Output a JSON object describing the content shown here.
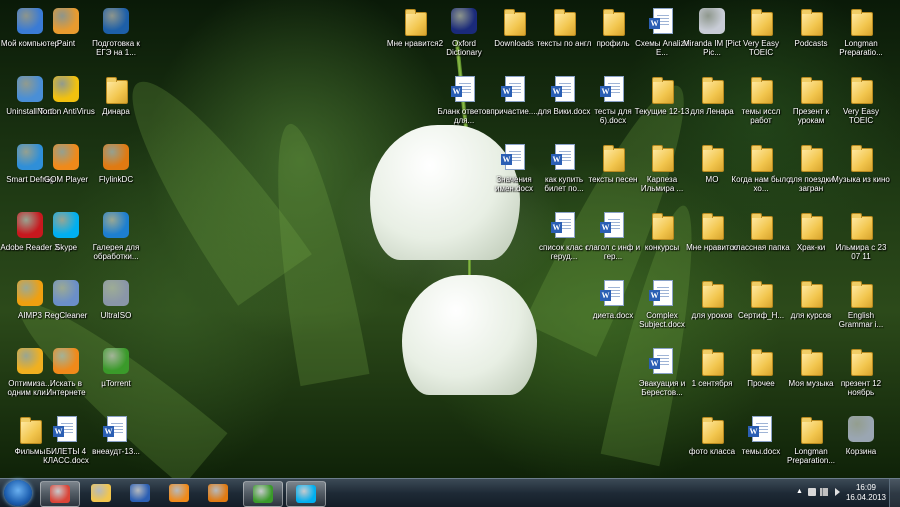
{
  "desktop": {
    "icons": [
      {
        "label": "Мой компьютер",
        "icon": "computer-icon",
        "kind": "app",
        "color": "#3a7bd5"
      },
      {
        "label": "Paint",
        "icon": "paint-icon",
        "kind": "app",
        "color": "#e89b2f"
      },
      {
        "label": "Подготовка к ЕГЭ на 1...",
        "icon": "ege-app-icon",
        "kind": "app",
        "color": "#1d5fa8"
      },
      {
        "label": "Мне нравится2",
        "icon": "folder-icon",
        "kind": "folder"
      },
      {
        "label": "Oxford Dictionary",
        "icon": "oxford-dictionary-icon",
        "kind": "app",
        "color": "#1a2a7a"
      },
      {
        "label": "Downloads",
        "icon": "folder-icon",
        "kind": "folder"
      },
      {
        "label": "тексты по англ",
        "icon": "folder-icon",
        "kind": "folder"
      },
      {
        "label": "профиль",
        "icon": "folder-icon",
        "kind": "folder"
      },
      {
        "label": "Схемы Analize E...",
        "icon": "document-icon",
        "kind": "doc"
      },
      {
        "label": "Miranda IM [Pict Pic...",
        "icon": "miranda-im-icon",
        "kind": "app",
        "color": "#c8ccd6"
      },
      {
        "label": "Very Easy TOEIC",
        "icon": "folder-icon",
        "kind": "folder"
      },
      {
        "label": "Podcasts",
        "icon": "folder-icon",
        "kind": "folder"
      },
      {
        "label": "Longman Preparatio...",
        "icon": "folder-icon",
        "kind": "folder"
      },
      {
        "label": "Uninstall Tool",
        "icon": "uninstall-tool-icon",
        "kind": "app",
        "color": "#4a8fd6"
      },
      {
        "label": "Norton AntiVirus",
        "icon": "norton-icon",
        "kind": "app",
        "color": "#f2c10f"
      },
      {
        "label": "Динара",
        "icon": "folder-icon",
        "kind": "folder"
      },
      {
        "label": "Бланк ответов для...",
        "icon": "document-icon",
        "kind": "doc"
      },
      {
        "label": "причастие....",
        "icon": "document-icon",
        "kind": "doc"
      },
      {
        "label": "для Вики.docx",
        "icon": "document-icon",
        "kind": "doc"
      },
      {
        "label": "тесты для 6).docx",
        "icon": "document-icon",
        "kind": "doc"
      },
      {
        "label": "Текущие 12-13",
        "icon": "folder-icon",
        "kind": "folder"
      },
      {
        "label": "для Ленара",
        "icon": "folder-icon",
        "kind": "folder"
      },
      {
        "label": "темы иссл работ",
        "icon": "folder-icon",
        "kind": "folder"
      },
      {
        "label": "Презент к урокам",
        "icon": "folder-icon",
        "kind": "folder"
      },
      {
        "label": "Very Easy TOEIC",
        "icon": "folder-icon",
        "kind": "folder"
      },
      {
        "label": "Smart Defrag",
        "icon": "smart-defrag-icon",
        "kind": "app",
        "color": "#2f8fd8"
      },
      {
        "label": "GOM Player",
        "icon": "gom-player-icon",
        "kind": "app",
        "color": "#f08a1a"
      },
      {
        "label": "FlylinkDC",
        "icon": "flylinkdc-icon",
        "kind": "app",
        "color": "#e07a12"
      },
      {
        "label": "Значения имен.docx",
        "icon": "document-icon",
        "kind": "doc"
      },
      {
        "label": "как купить билет по...",
        "icon": "document-icon",
        "kind": "doc"
      },
      {
        "label": "тексты песен",
        "icon": "folder-icon",
        "kind": "folder"
      },
      {
        "label": "Карпеза Ильмира ...",
        "icon": "folder-icon",
        "kind": "folder"
      },
      {
        "label": "МО",
        "icon": "folder-icon",
        "kind": "folder"
      },
      {
        "label": "Когда нам было хо...",
        "icon": "folder-icon",
        "kind": "folder"
      },
      {
        "label": "для поездки загран",
        "icon": "folder-icon",
        "kind": "folder"
      },
      {
        "label": "Музыка из кино",
        "icon": "folder-icon",
        "kind": "folder"
      },
      {
        "label": "Adobe Reader X",
        "icon": "adobe-reader-icon",
        "kind": "app",
        "color": "#c8181e"
      },
      {
        "label": "Skype",
        "icon": "skype-icon",
        "kind": "app",
        "color": "#00aff0"
      },
      {
        "label": "Галерея для обработки...",
        "icon": "gallery-icon",
        "kind": "app",
        "color": "#1d7fd0"
      },
      {
        "label": "список клас с геруд...",
        "icon": "document-icon",
        "kind": "doc"
      },
      {
        "label": "глагол с инф и гер...",
        "icon": "document-icon",
        "kind": "doc"
      },
      {
        "label": "конкурсы",
        "icon": "folder-icon",
        "kind": "folder"
      },
      {
        "label": "Мне нравится",
        "icon": "folder-icon",
        "kind": "folder"
      },
      {
        "label": "классная папка",
        "icon": "folder-icon",
        "kind": "folder"
      },
      {
        "label": "Храк-ки",
        "icon": "folder-icon",
        "kind": "folder"
      },
      {
        "label": "Ильмира с 23 07 11",
        "icon": "folder-icon",
        "kind": "folder"
      },
      {
        "label": "AIMP3",
        "icon": "aimp-icon",
        "kind": "app",
        "color": "#f0a010"
      },
      {
        "label": "RegCleaner",
        "icon": "regcleaner-icon",
        "kind": "app",
        "color": "#6b8fc8"
      },
      {
        "label": "UltraISO",
        "icon": "ultraiso-icon",
        "kind": "app",
        "color": "#8a96a8"
      },
      {
        "label": "диета.docx",
        "icon": "document-icon",
        "kind": "doc"
      },
      {
        "label": "Complex Subject.docx",
        "icon": "document-icon",
        "kind": "doc"
      },
      {
        "label": "для уроков",
        "icon": "folder-icon",
        "kind": "folder"
      },
      {
        "label": "Сертиф_Н...",
        "icon": "folder-icon",
        "kind": "folder"
      },
      {
        "label": "для курсов",
        "icon": "folder-icon",
        "kind": "folder"
      },
      {
        "label": "English Grammar i...",
        "icon": "folder-icon",
        "kind": "folder"
      },
      {
        "label": "Оптимиза... одним кли...",
        "icon": "optimizer-icon",
        "kind": "app",
        "color": "#f0b020"
      },
      {
        "label": "Искать в Интернете",
        "icon": "search-web-icon",
        "kind": "app",
        "color": "#f08a1a"
      },
      {
        "label": "µTorrent",
        "icon": "utorrent-icon",
        "kind": "app",
        "color": "#3a9a2a"
      },
      {
        "label": "Эвакуация и Берестов...",
        "icon": "document-icon",
        "kind": "doc"
      },
      {
        "label": "1 сентября",
        "icon": "folder-icon",
        "kind": "folder"
      },
      {
        "label": "Прочее",
        "icon": "folder-icon",
        "kind": "folder"
      },
      {
        "label": "Моя музыка",
        "icon": "folder-icon",
        "kind": "folder"
      },
      {
        "label": "презент 12 ноябрь",
        "icon": "folder-icon",
        "kind": "folder"
      },
      {
        "label": "Фильмы",
        "icon": "folder-icon",
        "kind": "folder"
      },
      {
        "label": "БИЛЕТЫ 4 КЛАСС.docx",
        "icon": "document-icon",
        "kind": "doc"
      },
      {
        "label": "внеаудт-13...",
        "icon": "document-icon",
        "kind": "doc"
      },
      {
        "label": "фото класса",
        "icon": "folder-icon",
        "kind": "folder"
      },
      {
        "label": "темы.docx",
        "icon": "document-icon",
        "kind": "doc"
      },
      {
        "label": "Longman Preparation...",
        "icon": "folder-icon",
        "kind": "folder"
      },
      {
        "label": "Корзина",
        "icon": "recycle-bin-icon",
        "kind": "app",
        "color": "#9aa6b2"
      }
    ]
  },
  "taskbar": {
    "start_icon": "windows-start-icon",
    "pinned": [
      {
        "icon": "chrome-icon",
        "color": "#db4437",
        "active": true
      },
      {
        "icon": "explorer-folder-icon",
        "color": "#f2c64e",
        "active": false
      },
      {
        "icon": "word-icon",
        "color": "#2b5fb4",
        "active": false
      },
      {
        "icon": "media-player-icon",
        "color": "#f08a1a",
        "active": false
      },
      {
        "icon": "flylinkdc-icon",
        "color": "#e07a12",
        "active": false
      },
      {
        "icon": "utorrent-icon",
        "color": "#3a9a2a",
        "active": true
      },
      {
        "icon": "skype-icon",
        "color": "#00aff0",
        "active": true
      }
    ],
    "tray_icons": [
      "show-hidden-icons-icon",
      "action-center-icon",
      "network-icon",
      "volume-icon"
    ],
    "clock": {
      "time": "16:09",
      "date": "16.04.2013"
    }
  }
}
